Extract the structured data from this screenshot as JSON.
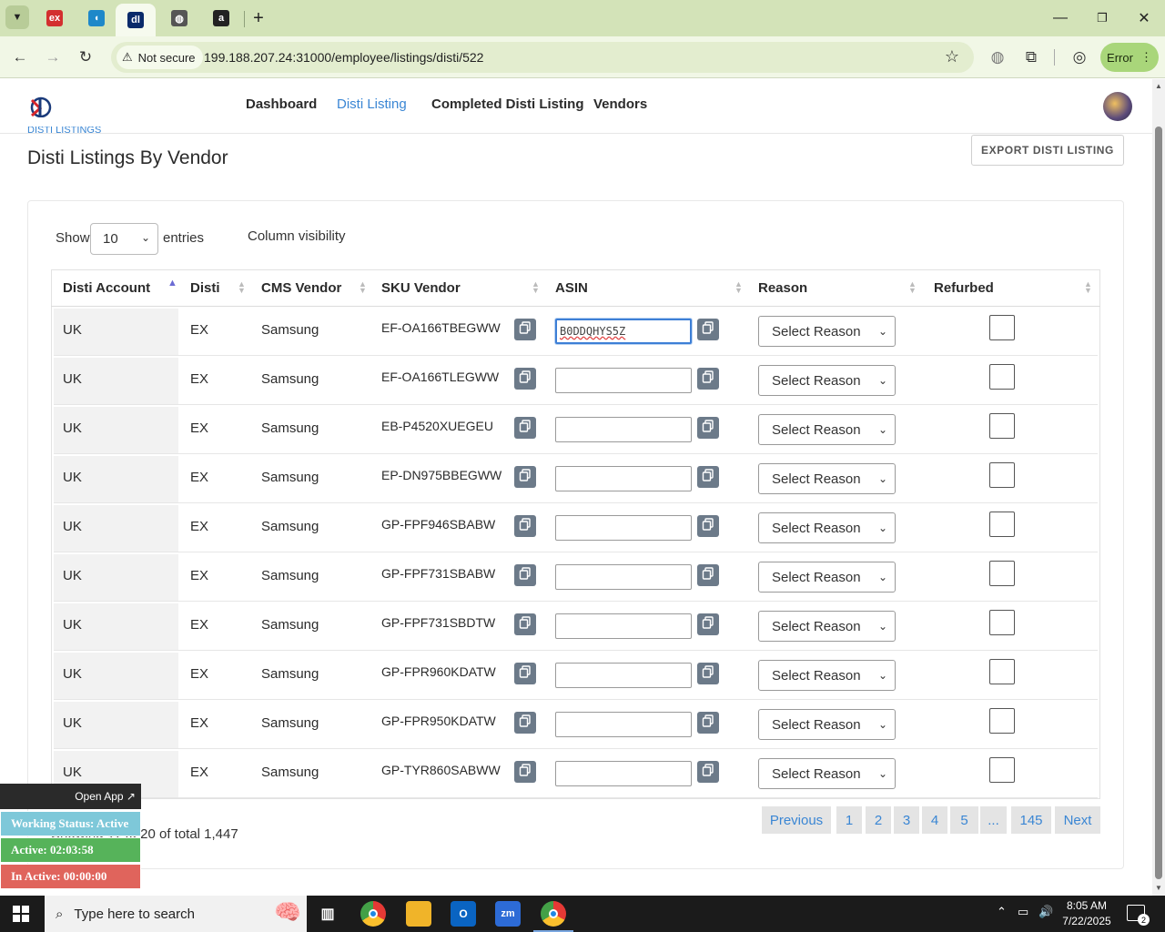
{
  "browser": {
    "tabs": [
      {
        "icon": "ebuyer-favicon",
        "letter": "ex",
        "color": "#d32f2f"
      },
      {
        "icon": "app-favicon",
        "letter": "◖",
        "color": "#1e88c9"
      },
      {
        "icon": "disti-favicon",
        "letter": "dl",
        "color": "#0a2a6a"
      },
      {
        "icon": "globe-favicon",
        "letter": "◍",
        "color": "#555555"
      },
      {
        "icon": "amazon-favicon",
        "letter": "a",
        "color": "#222222"
      }
    ],
    "new_tab": "+",
    "security_label": "Not secure",
    "url": "199.188.207.24:31000/employee/listings/disti/522",
    "profile_error": "Error"
  },
  "nav": {
    "links": [
      "Dashboard",
      "Disti Listing",
      "Completed Disti Listing",
      "Vendors"
    ],
    "active_index": 1
  },
  "page": {
    "breadcrumb": "DISTI LISTINGS",
    "title": "Disti Listings By Vendor",
    "export_label": "EXPORT DISTI LISTING"
  },
  "table_controls": {
    "show_label": "Show",
    "entries_value": "10",
    "entries_label": "entries",
    "column_visibility": "Column visibility"
  },
  "columns": [
    "Disti Account",
    "Disti",
    "CMS Vendor",
    "SKU Vendor",
    "ASIN",
    "Reason",
    "Refurbed"
  ],
  "reason_placeholder": "Select Reason",
  "rows": [
    {
      "account": "UK",
      "disti": "EX",
      "vendor": "Samsung",
      "sku": "EF-OA166TBEGWW",
      "asin": "B0DDQHYS5Z",
      "refurbed": false
    },
    {
      "account": "UK",
      "disti": "EX",
      "vendor": "Samsung",
      "sku": "EF-OA166TLEGWW",
      "asin": "",
      "refurbed": false
    },
    {
      "account": "UK",
      "disti": "EX",
      "vendor": "Samsung",
      "sku": "EB-P4520XUEGEU",
      "asin": "",
      "refurbed": false
    },
    {
      "account": "UK",
      "disti": "EX",
      "vendor": "Samsung",
      "sku": "EP-DN975BBEGWW",
      "asin": "",
      "refurbed": false
    },
    {
      "account": "UK",
      "disti": "EX",
      "vendor": "Samsung",
      "sku": "GP-FPF946SBABW",
      "asin": "",
      "refurbed": false
    },
    {
      "account": "UK",
      "disti": "EX",
      "vendor": "Samsung",
      "sku": "GP-FPF731SBABW",
      "asin": "",
      "refurbed": false
    },
    {
      "account": "UK",
      "disti": "EX",
      "vendor": "Samsung",
      "sku": "GP-FPF731SBDTW",
      "asin": "",
      "refurbed": false
    },
    {
      "account": "UK",
      "disti": "EX",
      "vendor": "Samsung",
      "sku": "GP-FPR960KDATW",
      "asin": "",
      "refurbed": false
    },
    {
      "account": "UK",
      "disti": "EX",
      "vendor": "Samsung",
      "sku": "GP-FPR950KDATW",
      "asin": "",
      "refurbed": false
    },
    {
      "account": "UK",
      "disti": "EX",
      "vendor": "Samsung",
      "sku": "GP-TYR860SABWW",
      "asin": "",
      "refurbed": false
    }
  ],
  "footer": {
    "info": "Showing 11 to 20 of total 1,447",
    "pages": [
      "Previous",
      "1",
      "2",
      "3",
      "4",
      "5",
      "...",
      "145",
      "Next"
    ]
  },
  "widget": {
    "open_app": "Open App ↗",
    "working_status": "Working Status: Active",
    "active": "Active: 02:03:58",
    "inactive": "In Active: 00:00:00",
    "colors": {
      "status": "#7ec8d9",
      "active": "#56b35a",
      "inactive": "#e0645c"
    }
  },
  "taskbar": {
    "search_placeholder": "Type here to search",
    "time": "8:05 AM",
    "date": "7/22/2025",
    "notifications": "2"
  }
}
